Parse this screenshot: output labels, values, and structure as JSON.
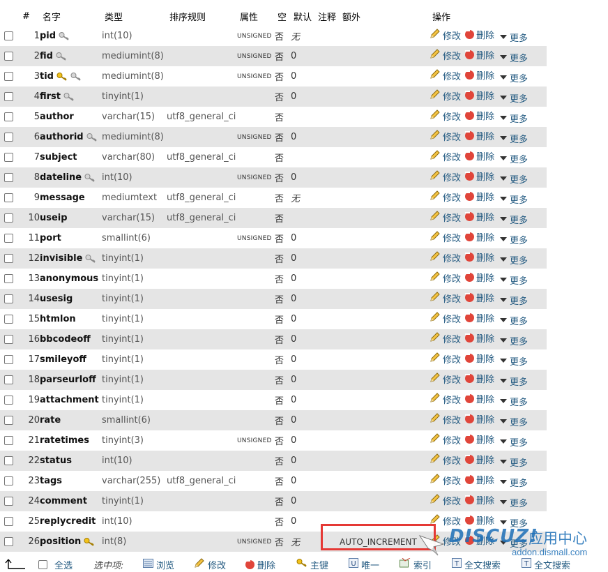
{
  "headers": {
    "num": "#",
    "name": "名字",
    "type": "类型",
    "collation": "排序规则",
    "attributes": "属性",
    "null": "空",
    "default": "默认",
    "comments": "注释",
    "extra": "额外",
    "action": "操作"
  },
  "actions": {
    "change": "修改",
    "drop": "删除",
    "more": "更多"
  },
  "rows": [
    {
      "num": "1",
      "name": "pid",
      "type": "int(10)",
      "collation": "",
      "attr": "UNSIGNED",
      "null": "否",
      "default": "无",
      "extra": ""
    },
    {
      "num": "2",
      "name": "fid",
      "type": "mediumint(8)",
      "collation": "",
      "attr": "UNSIGNED",
      "null": "否",
      "default": "0",
      "extra": ""
    },
    {
      "num": "3",
      "name": "tid",
      "type": "mediumint(8)",
      "collation": "",
      "attr": "UNSIGNED",
      "null": "否",
      "default": "0",
      "extra": ""
    },
    {
      "num": "4",
      "name": "first",
      "type": "tinyint(1)",
      "collation": "",
      "attr": "",
      "null": "否",
      "default": "0",
      "extra": ""
    },
    {
      "num": "5",
      "name": "author",
      "type": "varchar(15)",
      "collation": "utf8_general_ci",
      "attr": "",
      "null": "否",
      "default": "",
      "extra": ""
    },
    {
      "num": "6",
      "name": "authorid",
      "type": "mediumint(8)",
      "collation": "",
      "attr": "UNSIGNED",
      "null": "否",
      "default": "0",
      "extra": ""
    },
    {
      "num": "7",
      "name": "subject",
      "type": "varchar(80)",
      "collation": "utf8_general_ci",
      "attr": "",
      "null": "否",
      "default": "",
      "extra": ""
    },
    {
      "num": "8",
      "name": "dateline",
      "type": "int(10)",
      "collation": "",
      "attr": "UNSIGNED",
      "null": "否",
      "default": "0",
      "extra": ""
    },
    {
      "num": "9",
      "name": "message",
      "type": "mediumtext",
      "collation": "utf8_general_ci",
      "attr": "",
      "null": "否",
      "default": "无",
      "extra": ""
    },
    {
      "num": "10",
      "name": "useip",
      "type": "varchar(15)",
      "collation": "utf8_general_ci",
      "attr": "",
      "null": "否",
      "default": "",
      "extra": ""
    },
    {
      "num": "11",
      "name": "port",
      "type": "smallint(6)",
      "collation": "",
      "attr": "UNSIGNED",
      "null": "否",
      "default": "0",
      "extra": ""
    },
    {
      "num": "12",
      "name": "invisible",
      "type": "tinyint(1)",
      "collation": "",
      "attr": "",
      "null": "否",
      "default": "0",
      "extra": ""
    },
    {
      "num": "13",
      "name": "anonymous",
      "type": "tinyint(1)",
      "collation": "",
      "attr": "",
      "null": "否",
      "default": "0",
      "extra": ""
    },
    {
      "num": "14",
      "name": "usesig",
      "type": "tinyint(1)",
      "collation": "",
      "attr": "",
      "null": "否",
      "default": "0",
      "extra": ""
    },
    {
      "num": "15",
      "name": "htmlon",
      "type": "tinyint(1)",
      "collation": "",
      "attr": "",
      "null": "否",
      "default": "0",
      "extra": ""
    },
    {
      "num": "16",
      "name": "bbcodeoff",
      "type": "tinyint(1)",
      "collation": "",
      "attr": "",
      "null": "否",
      "default": "0",
      "extra": ""
    },
    {
      "num": "17",
      "name": "smileyoff",
      "type": "tinyint(1)",
      "collation": "",
      "attr": "",
      "null": "否",
      "default": "0",
      "extra": ""
    },
    {
      "num": "18",
      "name": "parseurloff",
      "type": "tinyint(1)",
      "collation": "",
      "attr": "",
      "null": "否",
      "default": "0",
      "extra": ""
    },
    {
      "num": "19",
      "name": "attachment",
      "type": "tinyint(1)",
      "collation": "",
      "attr": "",
      "null": "否",
      "default": "0",
      "extra": ""
    },
    {
      "num": "20",
      "name": "rate",
      "type": "smallint(6)",
      "collation": "",
      "attr": "",
      "null": "否",
      "default": "0",
      "extra": ""
    },
    {
      "num": "21",
      "name": "ratetimes",
      "type": "tinyint(3)",
      "collation": "",
      "attr": "UNSIGNED",
      "null": "否",
      "default": "0",
      "extra": ""
    },
    {
      "num": "22",
      "name": "status",
      "type": "int(10)",
      "collation": "",
      "attr": "",
      "null": "否",
      "default": "0",
      "extra": ""
    },
    {
      "num": "23",
      "name": "tags",
      "type": "varchar(255)",
      "collation": "utf8_general_ci",
      "attr": "",
      "null": "否",
      "default": "0",
      "extra": ""
    },
    {
      "num": "24",
      "name": "comment",
      "type": "tinyint(1)",
      "collation": "",
      "attr": "",
      "null": "否",
      "default": "0",
      "extra": ""
    },
    {
      "num": "25",
      "name": "replycredit",
      "type": "int(10)",
      "collation": "",
      "attr": "",
      "null": "否",
      "default": "0",
      "extra": ""
    },
    {
      "num": "26",
      "name": "position",
      "type": "int(8)",
      "collation": "",
      "attr": "UNSIGNED",
      "null": "否",
      "default": "无",
      "extra": "AUTO_INCREMENT"
    }
  ],
  "footer": {
    "check_all": "全选",
    "with_selected": "选中项:",
    "browse": "浏览",
    "change": "修改",
    "drop": "删除",
    "primary": "主键",
    "unique": "唯一",
    "index": "索引",
    "fulltext": "全文搜索",
    "fulltext2": "全文搜索"
  },
  "watermark": {
    "brand": "DISCUZ!",
    "suffix": "应用中心",
    "url": "addon.dismall.com"
  },
  "icons": {
    "row_key_1": "key-icon-gray",
    "row_key_3": "key-icon-gold-and-gray",
    "row_key_26": "key-icon-gold",
    "change": "pencil-icon",
    "drop": "minus-circle-icon",
    "more": "triangle-down-icon"
  },
  "colors": {
    "link": "#235a81",
    "row_alt": "#e5e5e5",
    "highlight": "#e53935",
    "drop": "#e0453a"
  }
}
